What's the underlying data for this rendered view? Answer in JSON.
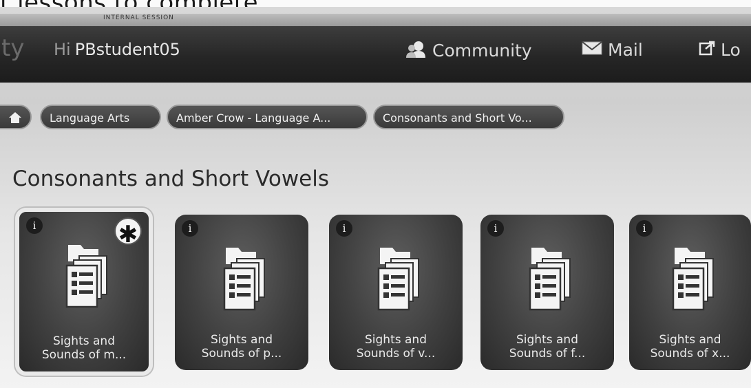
{
  "caption": {
    "text": "t lessons to complete."
  },
  "header": {
    "session_label": "INTERNAL SESSION",
    "brand_fragment": "ty",
    "greeting_prefix": "Hi",
    "username": "PBstudent05",
    "nav": [
      {
        "label": "Community",
        "icon": "community-icon"
      },
      {
        "label": "Mail",
        "icon": "mail-icon"
      },
      {
        "label": "Lo",
        "icon": "logout-icon"
      }
    ]
  },
  "breadcrumb": {
    "home_icon": "home-icon",
    "items": [
      {
        "label": "Language Arts"
      },
      {
        "label": "Amber Crow - Language A..."
      },
      {
        "label": "Consonants and Short Vo..."
      }
    ]
  },
  "main": {
    "title": "Consonants and Short Vowels",
    "tiles": [
      {
        "line1": "Sights and",
        "line2": "Sounds of m...",
        "info": "i",
        "starred": true,
        "star_symbol": "✱"
      },
      {
        "line1": "Sights and",
        "line2": "Sounds of p...",
        "info": "i",
        "starred": false
      },
      {
        "line1": "Sights and",
        "line2": "Sounds of v...",
        "info": "i",
        "starred": false
      },
      {
        "line1": "Sights and",
        "line2": "Sounds of f...",
        "info": "i",
        "starred": false
      },
      {
        "line1": "Sights and",
        "line2": "Sounds of x...",
        "info": "i",
        "starred": false
      }
    ]
  },
  "colors": {
    "topbar": "#262626",
    "tile": "#404040",
    "breadcrumb_pill": "#444444",
    "selected_border": "#e9e9e9"
  }
}
